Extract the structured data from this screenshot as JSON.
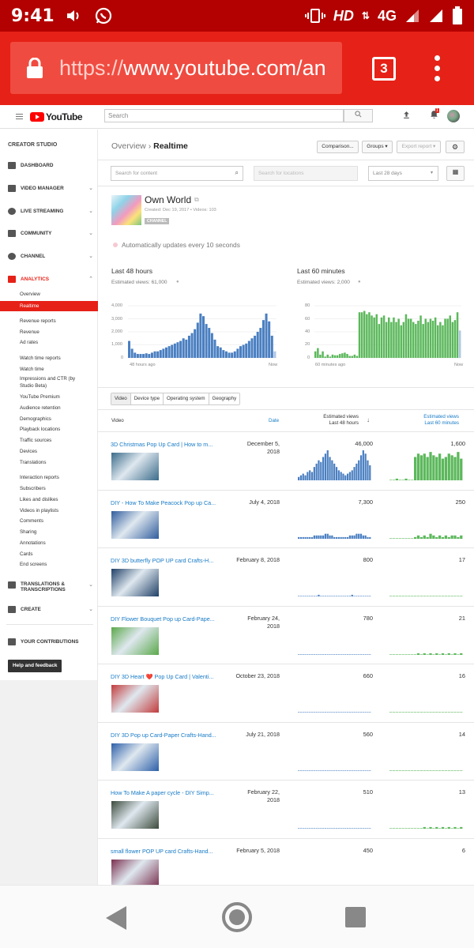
{
  "status_bar": {
    "time": "9:41",
    "network": "HD",
    "signal": "4G"
  },
  "browser": {
    "url_scheme": "https://",
    "url_host": "www.youtube.com/an",
    "tab_count": "3"
  },
  "yt_header": {
    "logo_text": "YouTube",
    "search_placeholder": "Search",
    "notification_count": "1"
  },
  "sidebar": {
    "title": "CREATOR STUDIO",
    "items": [
      {
        "label": "DASHBOARD",
        "chevron": false
      },
      {
        "label": "VIDEO MANAGER",
        "chevron": true
      },
      {
        "label": "LIVE STREAMING",
        "chevron": true
      },
      {
        "label": "COMMUNITY",
        "chevron": true
      },
      {
        "label": "CHANNEL",
        "chevron": true
      },
      {
        "label": "ANALYTICS",
        "chevron": true
      }
    ],
    "analytics_sub": [
      "Overview",
      "Realtime"
    ],
    "revenue_head": "Revenue reports",
    "revenue_items": [
      "Revenue",
      "Ad rates"
    ],
    "watch_head": "Watch time reports",
    "watch_items": [
      "Watch time",
      "Impressions and CTR (by",
      "Studio Beta)",
      "YouTube Premium",
      "Audience retention",
      "Demographics",
      "Playback locations",
      "Traffic sources",
      "Devices",
      "Translations"
    ],
    "interaction_head": "Interaction reports",
    "interaction_items": [
      "Subscribers",
      "Likes and dislikes",
      "Videos in playlists",
      "Comments",
      "Sharing",
      "Annotations",
      "Cards",
      "End screens"
    ],
    "translations_label_1": "TRANSLATIONS &",
    "translations_label_2": "TRANSCRIPTIONS",
    "create_label": "CREATE",
    "contributions_label": "YOUR CONTRIBUTIONS",
    "help_label": "Help and feedback"
  },
  "main": {
    "breadcrumb_parent": "Overview",
    "breadcrumb_sep": "›",
    "breadcrumb_current": "Realtime",
    "comparison_btn": "Comparison...",
    "groups_btn": "Groups ▾",
    "export_btn": "Export report ▾",
    "search_content_placeholder": "Search for content",
    "search_locations_placeholder": "Search for locations",
    "date_range": "Last 28 days",
    "channel_name": "Own World",
    "channel_meta": "Created: Dec 19, 2017  •  Videos: 103",
    "channel_badge": "CHANNEL",
    "auto_update": "Automatically updates every 10 seconds",
    "chart48_title": "Last 48 hours",
    "chart48_sub": "Estimated views: 61,000",
    "chart60_title": "Last 60 minutes",
    "chart60_sub": "Estimated views: 2,000",
    "tabs": [
      "Video",
      "Device type",
      "Operating system",
      "Geography"
    ],
    "col_video": "Video",
    "col_date": "Date",
    "col_48_1": "Estimated views",
    "col_48_2": "Last 48 hours",
    "col_60_1": "Estimated views",
    "col_60_2": "Last 60 minutes"
  },
  "chart_data": [
    {
      "type": "bar",
      "title": "Last 48 hours",
      "subtitle": "Estimated views: 61,000",
      "y_ticks": [
        "4,000",
        "3,000",
        "2,000",
        "1,000",
        "0"
      ],
      "ylim": [
        0,
        4000
      ],
      "x_labels": [
        "48 hours ago",
        "Now"
      ],
      "color": "#4a7fc1",
      "values": [
        1300,
        700,
        400,
        300,
        300,
        300,
        350,
        300,
        400,
        500,
        500,
        600,
        700,
        800,
        900,
        1000,
        1100,
        1200,
        1300,
        1500,
        1400,
        1700,
        1900,
        2200,
        2700,
        3400,
        3200,
        2600,
        2300,
        1900,
        1400,
        900,
        800,
        600,
        500,
        400,
        400,
        500,
        700,
        900,
        1000,
        1100,
        1300,
        1500,
        1700,
        2000,
        2300,
        2900,
        3400,
        2800,
        1700,
        500
      ]
    },
    {
      "type": "bar",
      "title": "Last 60 minutes",
      "subtitle": "Estimated views: 2,000",
      "y_ticks": [
        "80",
        "60",
        "40",
        "20",
        "0"
      ],
      "ylim": [
        0,
        80
      ],
      "x_labels": [
        "60 minutes ago",
        "Now"
      ],
      "color": "#5cb85c",
      "values": [
        10,
        15,
        5,
        10,
        2,
        5,
        2,
        5,
        4,
        4,
        6,
        7,
        8,
        6,
        3,
        3,
        5,
        3,
        70,
        70,
        72,
        67,
        70,
        65,
        62,
        67,
        52,
        62,
        65,
        55,
        62,
        55,
        62,
        55,
        60,
        50,
        55,
        67,
        60,
        60,
        55,
        52,
        57,
        65,
        52,
        60,
        55,
        60,
        57,
        62,
        50,
        55,
        50,
        60,
        60,
        65,
        55,
        58,
        70,
        42
      ]
    }
  ],
  "videos": [
    {
      "title": "3D Christmas Pop Up Card | How to m...",
      "date_line1": "December 5,",
      "date_line2": "2018",
      "views48": "46,000",
      "views60": "1,600",
      "thumb": "#3a6b8a",
      "s48": [
        2,
        3,
        4,
        3,
        5,
        6,
        5,
        8,
        10,
        12,
        11,
        14,
        16,
        18,
        14,
        12,
        10,
        8,
        6,
        5,
        4,
        3,
        4,
        5,
        6,
        8,
        10,
        12,
        15,
        18,
        16,
        12,
        9
      ],
      "s60": [
        0,
        0,
        1,
        0,
        0,
        1,
        0,
        0,
        14,
        16,
        15,
        16,
        14,
        17,
        15,
        14,
        16,
        13,
        14,
        16,
        15,
        14,
        17,
        13
      ]
    },
    {
      "title": "DIY - How To Make Peacock Pop up Ca...",
      "date_line1": "July 4, 2018",
      "date_line2": "",
      "views48": "7,300",
      "views60": "250",
      "thumb": "#2f5c9c",
      "s48": [
        1,
        1,
        1,
        1,
        1,
        1,
        1,
        2,
        2,
        2,
        2,
        2,
        3,
        3,
        2,
        2,
        1,
        1,
        1,
        1,
        1,
        1,
        1,
        2,
        2,
        2,
        3,
        3,
        3,
        2,
        2,
        1,
        1
      ],
      "s60": [
        0,
        0,
        0,
        0,
        0,
        0,
        0,
        0,
        1,
        2,
        1,
        2,
        1,
        3,
        2,
        1,
        2,
        1,
        2,
        1,
        2,
        2,
        1,
        2
      ]
    },
    {
      "title": "DIY 3D butterfly POP UP card Crafts-H...",
      "date_line1": "February 8, 2018",
      "date_line2": "",
      "views48": "800",
      "views60": "17",
      "thumb": "#1f3f66",
      "s48": [
        0,
        0,
        0,
        0,
        0,
        0,
        0,
        0,
        0,
        1,
        0,
        0,
        0,
        0,
        0,
        0,
        0,
        0,
        0,
        0,
        0,
        0,
        0,
        0,
        1,
        0,
        0,
        0,
        0,
        0,
        0,
        0,
        0
      ],
      "s60": [
        0,
        0,
        0,
        0,
        0,
        0,
        0,
        0,
        0,
        0,
        0,
        0,
        0,
        0,
        0,
        0,
        0,
        0,
        0,
        0,
        0,
        0,
        0,
        0
      ]
    },
    {
      "title": "DIY Flower Bouquet Pop up Card-Pape...",
      "date_line1": "February 24,",
      "date_line2": "2018",
      "views48": "780",
      "views60": "21",
      "thumb": "#5aa84a",
      "s48": [
        0,
        0,
        0,
        0,
        0,
        0,
        0,
        0,
        0,
        0,
        0,
        0,
        0,
        0,
        0,
        0,
        0,
        0,
        0,
        0,
        0,
        0,
        0,
        0,
        0,
        0,
        0,
        0,
        0,
        0,
        0,
        0,
        0
      ],
      "s60": [
        0,
        0,
        0,
        0,
        0,
        0,
        0,
        0,
        0,
        1,
        0,
        1,
        0,
        1,
        0,
        1,
        0,
        1,
        0,
        1,
        0,
        1,
        0,
        1
      ]
    },
    {
      "title": "DIY 3D Heart ❤️ Pop Up Card | Valenti...",
      "date_line1": "October 23, 2018",
      "date_line2": "",
      "views48": "660",
      "views60": "16",
      "thumb": "#c23b3b",
      "s48": [
        0,
        0,
        0,
        0,
        0,
        0,
        0,
        0,
        0,
        0,
        0,
        0,
        0,
        0,
        0,
        0,
        0,
        0,
        0,
        0,
        0,
        0,
        0,
        0,
        0,
        0,
        0,
        0,
        0,
        0,
        0,
        0,
        0
      ],
      "s60": [
        0,
        0,
        0,
        0,
        0,
        0,
        0,
        0,
        0,
        0,
        0,
        0,
        0,
        0,
        0,
        0,
        0,
        0,
        0,
        0,
        0,
        0,
        0,
        0
      ]
    },
    {
      "title": "DIY 3D Pop up Card-Paper Crafts-Hand...",
      "date_line1": "July 21, 2018",
      "date_line2": "",
      "views48": "560",
      "views60": "14",
      "thumb": "#2c5fa8",
      "s48": [
        0,
        0,
        0,
        0,
        0,
        0,
        0,
        0,
        0,
        0,
        0,
        0,
        0,
        0,
        0,
        0,
        0,
        0,
        0,
        0,
        0,
        0,
        0,
        0,
        0,
        0,
        0,
        0,
        0,
        0,
        0,
        0,
        0
      ],
      "s60": [
        0,
        0,
        0,
        0,
        0,
        0,
        0,
        0,
        0,
        0,
        0,
        0,
        0,
        0,
        0,
        0,
        0,
        0,
        0,
        0,
        0,
        0,
        0,
        0
      ]
    },
    {
      "title": "How To Make A paper cycle - DIY Simp...",
      "date_line1": "February 22,",
      "date_line2": "2018",
      "views48": "510",
      "views60": "13",
      "thumb": "#3b4a3b",
      "s48": [
        0,
        0,
        0,
        0,
        0,
        0,
        0,
        0,
        0,
        0,
        0,
        0,
        0,
        0,
        0,
        0,
        0,
        0,
        0,
        0,
        0,
        0,
        0,
        0,
        0,
        0,
        0,
        0,
        0,
        0,
        0,
        0,
        0
      ],
      "s60": [
        0,
        0,
        0,
        0,
        0,
        0,
        0,
        0,
        0,
        0,
        0,
        1,
        0,
        1,
        0,
        1,
        0,
        1,
        0,
        1,
        0,
        1,
        0,
        1
      ]
    },
    {
      "title": "small flower POP UP card Crafts-Hand...",
      "date_line1": "February 5, 2018",
      "date_line2": "",
      "views48": "450",
      "views60": "6",
      "thumb": "#7a2f4f",
      "s48": [
        0,
        0,
        0,
        0,
        0,
        0,
        0,
        0,
        0,
        0,
        0,
        0,
        0,
        0,
        0,
        0,
        0,
        0,
        0,
        0,
        0,
        0,
        0,
        0,
        0,
        0,
        0,
        0,
        0,
        0,
        0,
        0,
        0
      ],
      "s60": [
        0,
        0,
        0,
        0,
        0,
        0,
        0,
        0,
        0,
        0,
        0,
        0,
        0,
        0,
        0,
        0,
        0,
        0,
        0,
        0,
        0,
        0,
        0,
        0
      ]
    }
  ]
}
